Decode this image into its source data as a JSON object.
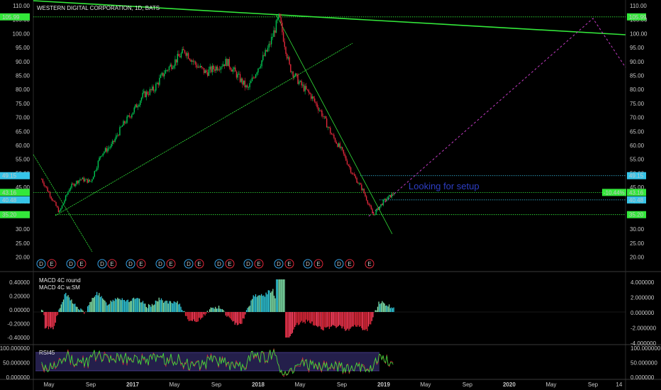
{
  "title": "WESTERN DIGITAL CORPORATION, 1D, BATS",
  "colors": {
    "background": "#000000",
    "bull": "#00c853",
    "bear": "#e0283a",
    "trendline": "#33e83a",
    "projection": "#c23bc2",
    "level_cyan": "#36c4e8",
    "level_green": "#33e83a",
    "annotation_text": "#2d3ec4",
    "event_d": "#36a3e8",
    "event_e": "#e0283a",
    "macd_pos": "#7fe0a8",
    "macd_neg": "#e0283a",
    "rsi_band": "#2a2458",
    "rsi_line": "#33e83a"
  },
  "chart_data": [
    {
      "type": "candlestick",
      "panel": "price",
      "ylim": [
        17,
        111
      ],
      "ytick_labels": [
        "110.00",
        "105.00",
        "100.00",
        "95.00",
        "90.00",
        "85.00",
        "80.00",
        "75.00",
        "70.00",
        "65.00",
        "60.00",
        "55.00",
        "50.00",
        "45.00",
        "40.00",
        "35.00",
        "30.00",
        "25.00",
        "20.00"
      ],
      "xtick_labels": [
        "May",
        "Sep",
        "2017",
        "May",
        "Sep",
        "2018",
        "May",
        "Sep",
        "2019",
        "May",
        "Sep",
        "2020",
        "May",
        "Sep",
        "14"
      ],
      "price_path": [
        {
          "t": "2016-04",
          "v": 50
        },
        {
          "t": "2016-05",
          "v": 43
        },
        {
          "t": "2016-06",
          "v": 36
        },
        {
          "t": "2016-07",
          "v": 45
        },
        {
          "t": "2016-08",
          "v": 48
        },
        {
          "t": "2016-09",
          "v": 47
        },
        {
          "t": "2016-10",
          "v": 57
        },
        {
          "t": "2016-11",
          "v": 60
        },
        {
          "t": "2016-12",
          "v": 67
        },
        {
          "t": "2017-01",
          "v": 72
        },
        {
          "t": "2017-02",
          "v": 78
        },
        {
          "t": "2017-03",
          "v": 80
        },
        {
          "t": "2017-04",
          "v": 86
        },
        {
          "t": "2017-05",
          "v": 90
        },
        {
          "t": "2017-06",
          "v": 94
        },
        {
          "t": "2017-07",
          "v": 89
        },
        {
          "t": "2017-08",
          "v": 86
        },
        {
          "t": "2017-09",
          "v": 88
        },
        {
          "t": "2017-10",
          "v": 90
        },
        {
          "t": "2017-11",
          "v": 85
        },
        {
          "t": "2017-12",
          "v": 80
        },
        {
          "t": "2018-01",
          "v": 88
        },
        {
          "t": "2018-02",
          "v": 95
        },
        {
          "t": "2018-03",
          "v": 106
        },
        {
          "t": "2018-04",
          "v": 88
        },
        {
          "t": "2018-05",
          "v": 82
        },
        {
          "t": "2018-06",
          "v": 78
        },
        {
          "t": "2018-07",
          "v": 72
        },
        {
          "t": "2018-08",
          "v": 64
        },
        {
          "t": "2018-09",
          "v": 58
        },
        {
          "t": "2018-10",
          "v": 50
        },
        {
          "t": "2018-11",
          "v": 44
        },
        {
          "t": "2018-12",
          "v": 35
        },
        {
          "t": "2019-01",
          "v": 40
        },
        {
          "t": "2019-02",
          "v": 43
        }
      ],
      "levels": [
        {
          "value": 105.99,
          "label": "105.99",
          "color": "#33e83a"
        },
        {
          "value": 49.15,
          "label": "49.15",
          "color": "#36c4e8"
        },
        {
          "value": 43.16,
          "label": "43.16",
          "color": "#33e83a"
        },
        {
          "value": 40.48,
          "label": "40.48",
          "color": "#36c4e8"
        },
        {
          "value": 35.2,
          "label": "35.20",
          "color": "#33e83a"
        }
      ],
      "current_change_label": "-10.44%",
      "annotation": "Looking for setup",
      "events": [
        "D",
        "E",
        "D",
        "E",
        "D",
        "E",
        "D",
        "E",
        "D",
        "E",
        "D",
        "E",
        "D",
        "E",
        "D",
        "E",
        "D",
        "E",
        "D",
        "E",
        "D",
        "E",
        "E"
      ]
    },
    {
      "type": "histogram",
      "panel": "macd",
      "legend": [
        "MACD 4C round",
        "MACD 4C w.SM"
      ],
      "ytick_labels_left": [
        "0.40000",
        "0.20000",
        "0.00000",
        "-0.20000",
        "-0.40000"
      ],
      "ytick_labels_right": [
        "4.000000",
        "2.000000",
        "0.000000",
        "-2.000000",
        "-4.000000"
      ],
      "ylim": [
        -0.5,
        0.5
      ]
    },
    {
      "type": "line",
      "panel": "rsi",
      "legend": [
        "RSI45"
      ],
      "ytick_labels_left": [
        "100.000000",
        "50.000000",
        "0.000000"
      ],
      "ytick_labels_right": [
        "100.000000",
        "50.000000",
        "0.000000"
      ],
      "ylim": [
        0,
        100
      ]
    }
  ]
}
